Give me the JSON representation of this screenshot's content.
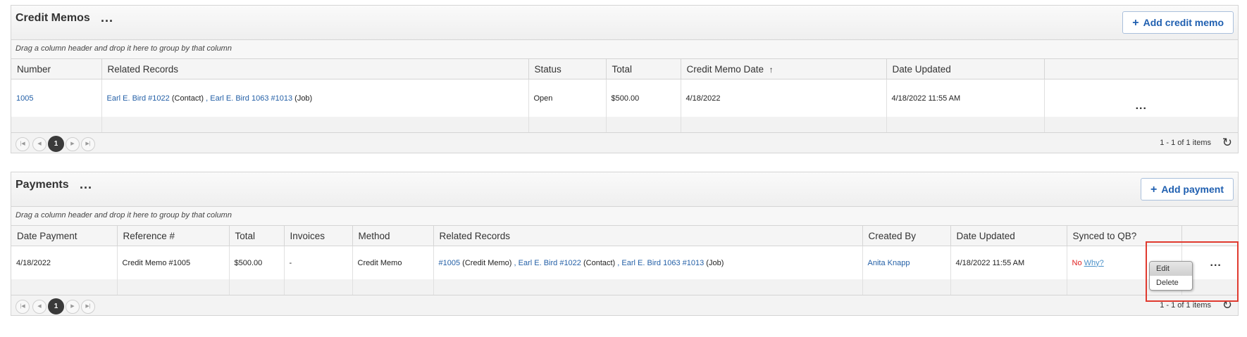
{
  "credit_memos": {
    "title": "Credit Memos",
    "more": "...",
    "add_button": "Add credit memo",
    "add_icon": "plus-icon",
    "group_hint": "Drag a column header and drop it here to group by that column",
    "columns": {
      "number": "Number",
      "related": "Related Records",
      "status": "Status",
      "total": "Total",
      "date": "Credit Memo Date",
      "sort_arrow": "↑",
      "updated": "Date Updated"
    },
    "row": {
      "number": "1005",
      "rel1": "Earl E. Bird #1022",
      "rel1_type": "(Contact)",
      "sep": ",",
      "rel2": "Earl E. Bird 1063 #1013",
      "rel2_type": "(Job)",
      "status": "Open",
      "total": "$500.00",
      "date": "4/18/2022",
      "updated": "4/18/2022 11:55 AM",
      "actions": "..."
    },
    "pager": {
      "page": "1",
      "info": "1 - 1 of 1 items"
    }
  },
  "payments": {
    "title": "Payments",
    "more": "...",
    "add_button": "Add payment",
    "add_icon": "plus-icon",
    "group_hint": "Drag a column header and drop it here to group by that column",
    "columns": {
      "date": "Date Payment",
      "ref": "Reference #",
      "total": "Total",
      "invoices": "Invoices",
      "method": "Method",
      "related": "Related Records",
      "created": "Created By",
      "updated": "Date Updated",
      "synced": "Synced to QB?"
    },
    "row": {
      "date": "4/18/2022",
      "ref": "Credit Memo #1005",
      "total": "$500.00",
      "invoices": "-",
      "method": "Credit Memo",
      "rel1": "#1005",
      "rel1_type": "(Credit Memo)",
      "sep": ",",
      "rel2": "Earl E. Bird #1022",
      "rel2_type": "(Contact)",
      "rel3": "Earl E. Bird 1063 #1013",
      "rel3_type": "(Job)",
      "created": "Anita Knapp",
      "updated": "4/18/2022 11:55 AM",
      "synced_no": "No",
      "synced_why": "Why?",
      "actions": "..."
    },
    "pager": {
      "page": "1",
      "info": "1 - 1 of 1 items"
    }
  },
  "context_menu": {
    "edit": "Edit",
    "delete": "Delete"
  },
  "colors": {
    "link": "#2460a7",
    "highlight": "#e03a2f",
    "no_status": "#e02020"
  }
}
